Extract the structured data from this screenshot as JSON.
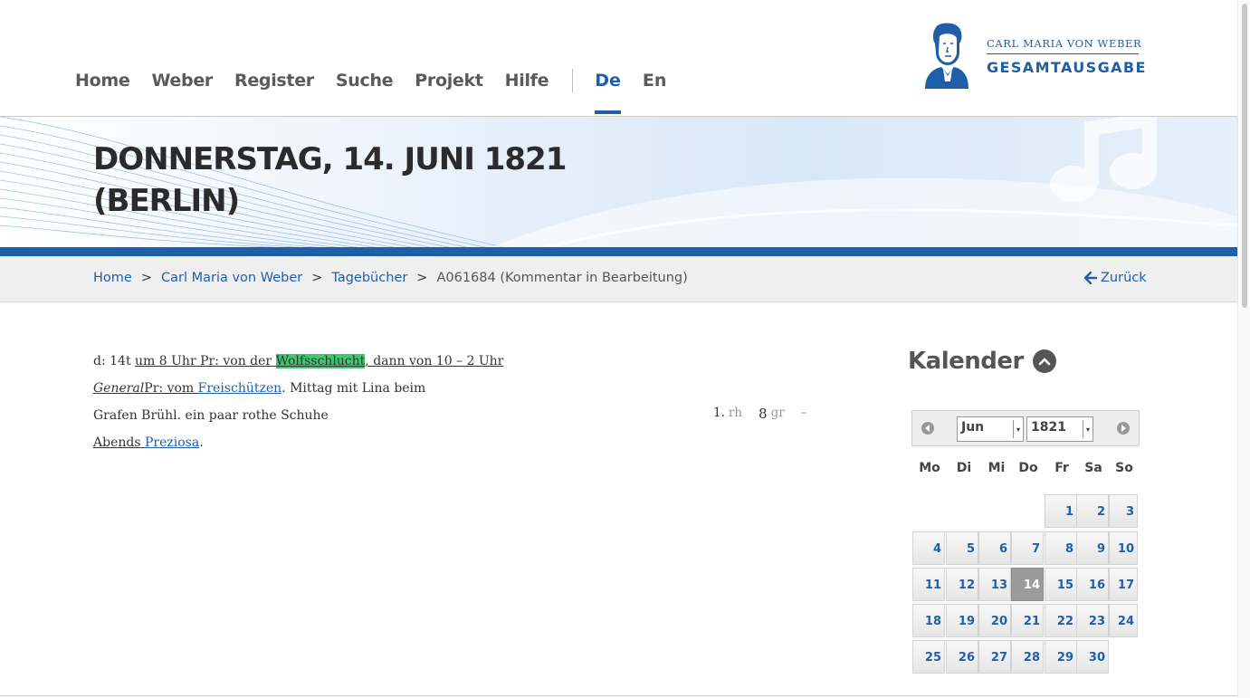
{
  "nav": {
    "items": [
      "Home",
      "Weber",
      "Register",
      "Suche",
      "Projekt",
      "Hilfe"
    ],
    "lang_active": "De",
    "lang_other": "En"
  },
  "logo": {
    "line1": "CARL MARIA VON WEBER",
    "line2": "GESAMTAUSGABE"
  },
  "banner": {
    "title_line1": "DONNERSTAG, 14. JUNI 1821",
    "title_line2": "(BERLIN)"
  },
  "breadcrumb": {
    "items": [
      "Home",
      "Carl Maria von Weber",
      "Tagebücher"
    ],
    "current": "A061684 (Kommentar in Bearbeitung)",
    "back_label": "Zurück"
  },
  "diary": {
    "l1_a": "d: 14t ",
    "l1_b": "um 8 Uhr Pr: von der ",
    "l1_hl": "Wolfsschlucht",
    "l1_c": ", dann von 10 – 2 Uhr",
    "l2_ital": "General",
    "l2_a": "Pr: vom ",
    "l2_link": "Freischützen",
    "l2_b": ". Mittag mit Lina beim",
    "l3": "Grafen Brühl. ein paar rothe Schuhe",
    "l4_a": "Abends",
    "l4_sp": " ",
    "l4_link": "Preziosa",
    "l4_b": "."
  },
  "money": {
    "n1": "1.",
    "u1": "rh",
    "n2": "8",
    "u2": "gr",
    "dash": "–"
  },
  "calendar": {
    "title": "Kalender",
    "month": "Jun",
    "year": "1821",
    "weekdays": [
      "Mo",
      "Di",
      "Mi",
      "Do",
      "Fr",
      "Sa",
      "So"
    ],
    "selected_day": 14,
    "days": [
      "1",
      "2",
      "3",
      "4",
      "5",
      "6",
      "7",
      "8",
      "9",
      "10",
      "11",
      "12",
      "13",
      "14",
      "15",
      "16",
      "17",
      "18",
      "19",
      "20",
      "21",
      "22",
      "23",
      "24",
      "25",
      "26",
      "27",
      "28",
      "29",
      "30"
    ]
  },
  "colors": {
    "accent": "#1f5fa8",
    "highlight": "#3cc870"
  }
}
